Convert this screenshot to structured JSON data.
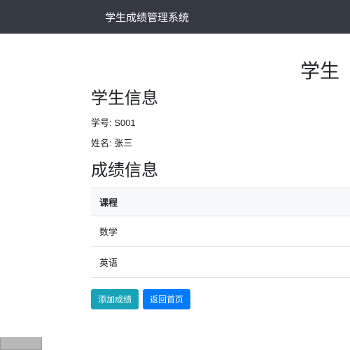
{
  "navbar": {
    "title": "学生成绩管理系统"
  },
  "page": {
    "title_partial": "学生"
  },
  "student_info": {
    "heading": "学生信息",
    "id_label": "学号:",
    "id_value": "S001",
    "name_label": "姓名:",
    "name_value": "张三"
  },
  "grades": {
    "heading": "成绩信息",
    "column_header": "课程",
    "rows": [
      {
        "course": "数学"
      },
      {
        "course": "英语"
      }
    ]
  },
  "buttons": {
    "add_grade": "添加成绩",
    "back_home": "返回首页"
  }
}
